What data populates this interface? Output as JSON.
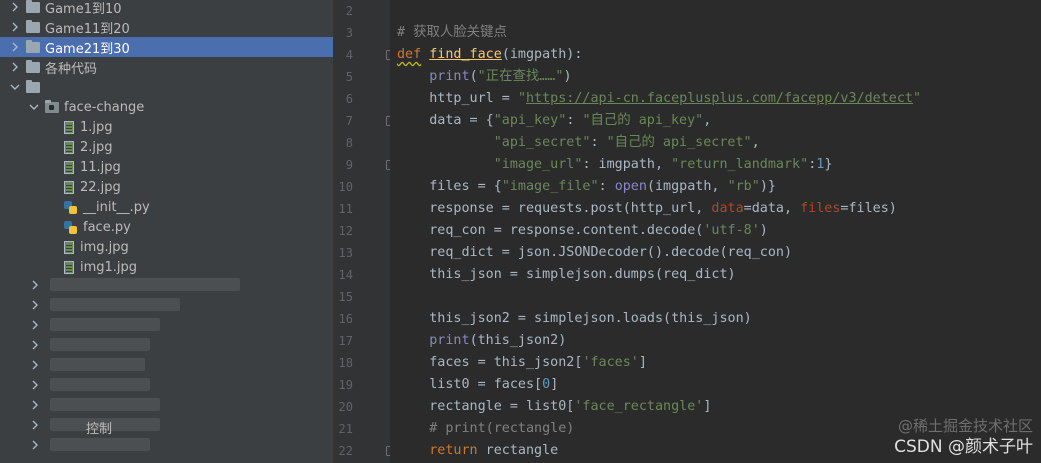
{
  "tree": {
    "items": [
      {
        "label": "Game1到10",
        "type": "folder",
        "expanded": false,
        "indent": 0
      },
      {
        "label": "Game11到20",
        "type": "folder",
        "expanded": false,
        "indent": 0
      },
      {
        "label": "Game21到30",
        "type": "folder",
        "expanded": false,
        "indent": 0,
        "selected": true
      },
      {
        "label": "各种代码",
        "type": "folder",
        "expanded": false,
        "indent": 0
      },
      {
        "label": "",
        "type": "folder",
        "expanded": true,
        "indent": 0
      },
      {
        "label": "face-change",
        "type": "module-folder",
        "expanded": true,
        "indent": 1
      },
      {
        "label": "1.jpg",
        "type": "jpg",
        "indent": 2
      },
      {
        "label": "2.jpg",
        "type": "jpg",
        "indent": 2
      },
      {
        "label": "11.jpg",
        "type": "jpg",
        "indent": 2
      },
      {
        "label": "22.jpg",
        "type": "jpg",
        "indent": 2
      },
      {
        "label": "__init__.py",
        "type": "py",
        "indent": 2
      },
      {
        "label": "face.py",
        "type": "py",
        "indent": 2
      },
      {
        "label": "img.jpg",
        "type": "jpg",
        "indent": 2
      },
      {
        "label": "img1.jpg",
        "type": "jpg",
        "indent": 2
      }
    ],
    "partial_labels": [
      "控制"
    ]
  },
  "editor": {
    "lines": [
      {
        "n": "2",
        "html": ""
      },
      {
        "n": "3",
        "html": "<span class=\"cm\"># 获取人脸关键点</span>"
      },
      {
        "n": "4",
        "html": "<span class=\"kw squig\">def</span> <span class=\"fn ulfn\">find_face</span>(imgpath):"
      },
      {
        "n": "5",
        "html": "    <span class=\"bi\">print</span>(<span class=\"st\">\"正在查找……\"</span>)"
      },
      {
        "n": "6",
        "html": "    http_url = <span class=\"st\">\"</span><span class=\"url\">https://api-cn.faceplusplus.com/facepp/v3/detect</span><span class=\"st\">\"</span>"
      },
      {
        "n": "7",
        "html": "    data = {<span class=\"st\">\"api_key\"</span>: <span class=\"st\">\"自己的 api_key\"</span>,"
      },
      {
        "n": "8",
        "html": "            <span class=\"st\">\"api_secret\"</span>: <span class=\"st\">\"自己的 api_secret\"</span>,"
      },
      {
        "n": "9",
        "html": "            <span class=\"st\">\"image_url\"</span>: imgpath, <span class=\"st\">\"return_landmark\"</span>:<span class=\"nm\">1</span>}"
      },
      {
        "n": "10",
        "html": "    files = {<span class=\"st\">\"image_file\"</span>: <span class=\"bi\">open</span>(imgpath, <span class=\"st\">\"rb\"</span>)}"
      },
      {
        "n": "11",
        "html": "    response = requests.post(http_url, <span class=\"pm\">data</span>=data, <span class=\"pm\">files</span>=files)"
      },
      {
        "n": "12",
        "html": "    req_con = response.content.decode(<span class=\"st\">'utf-8'</span>)"
      },
      {
        "n": "13",
        "html": "    req_dict = json.JSONDecoder().decode(req_con)"
      },
      {
        "n": "14",
        "html": "    this_json = simplejson.dumps(req_dict)"
      },
      {
        "n": "15",
        "html": ""
      },
      {
        "n": "16",
        "html": "    this_json2 = simplejson.loads(this_json)"
      },
      {
        "n": "17",
        "html": "    <span class=\"bi\">print</span>(this_json2)"
      },
      {
        "n": "18",
        "html": "    faces = this_json2[<span class=\"st\">'faces'</span>]"
      },
      {
        "n": "19",
        "html": "    list0 = faces[<span class=\"nm\">0</span>]"
      },
      {
        "n": "20",
        "html": "    rectangle = list0[<span class=\"st\">'face_rectangle'</span>]"
      },
      {
        "n": "21",
        "html": "    <span class=\"cm\"># print(rectangle)</span>"
      },
      {
        "n": "22",
        "html": "    <span class=\"kw\">return</span> rectangle"
      }
    ]
  },
  "watermark": {
    "line1": "@稀土掘金技术社区",
    "line2": "CSDN @颜术子叶"
  },
  "colors": {
    "selection": "#4b6eaf",
    "keyword": "#cc7832",
    "string": "#6a8759",
    "function": "#ffc66d",
    "builtin": "#8888c6",
    "number": "#6897bb",
    "comment": "#808080"
  }
}
